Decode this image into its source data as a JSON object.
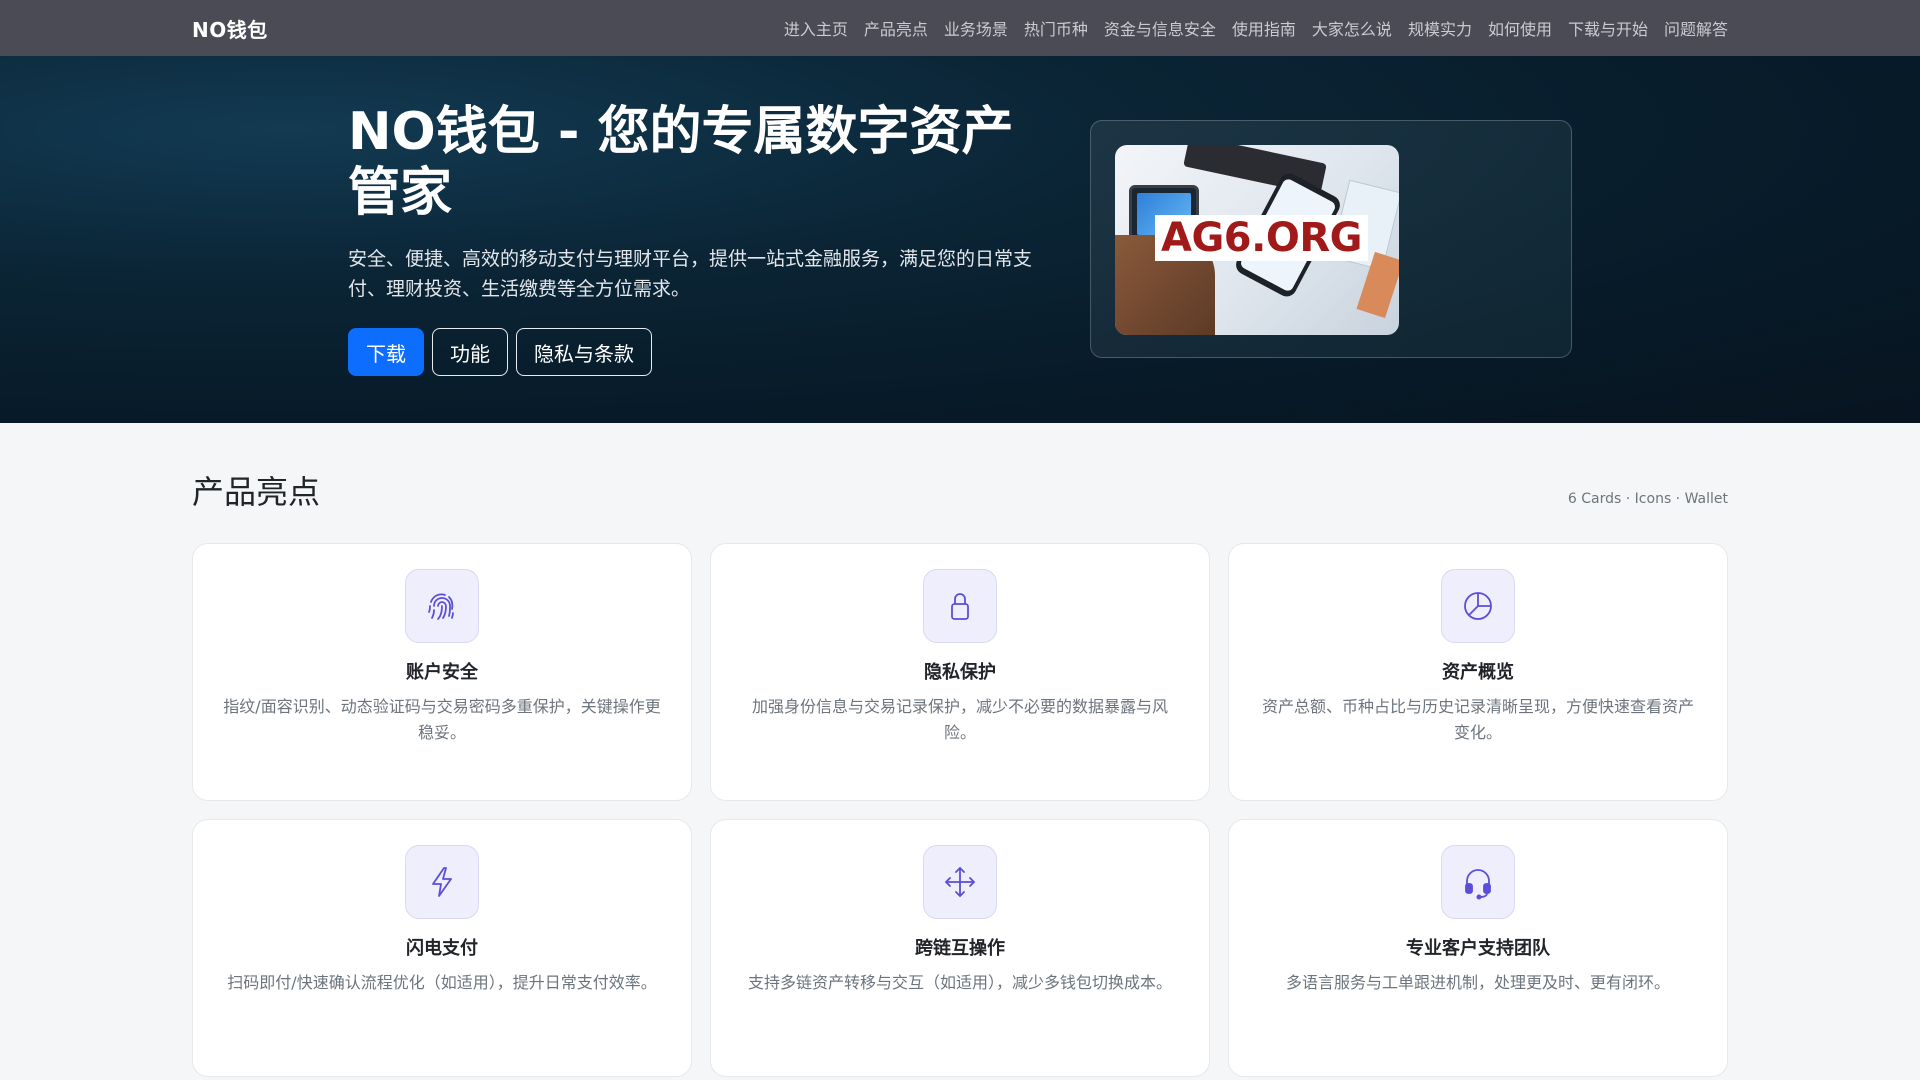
{
  "nav": {
    "brand": "NO钱包",
    "links": [
      "进入主页",
      "产品亮点",
      "业务场景",
      "热门币种",
      "资金与信息安全",
      "使用指南",
      "大家怎么说",
      "规模实力",
      "如何使用",
      "下载与开始",
      "问题解答"
    ]
  },
  "hero": {
    "title": "NO钱包 - 您的专属数字资产管家",
    "subtitle": "安全、便捷、高效的移动支付与理财平台，提供一站式金融服务，满足您的日常支付、理财投资、生活缴费等全方位需求。",
    "buttons": {
      "download": "下载",
      "features": "功能",
      "privacy": "隐私与条款"
    },
    "image_watermark": "AG6.ORG"
  },
  "features": {
    "title": "产品亮点",
    "meta": "6 Cards · Icons · Wallet",
    "cards": [
      {
        "icon": "fingerprint-icon",
        "title": "账户安全",
        "desc": "指纹/面容识别、动态验证码与交易密码多重保护，关键操作更稳妥。"
      },
      {
        "icon": "lock-icon",
        "title": "隐私保护",
        "desc": "加强身份信息与交易记录保护，减少不必要的数据暴露与风险。"
      },
      {
        "icon": "pie-chart-icon",
        "title": "资产概览",
        "desc": "资产总额、币种占比与历史记录清晰呈现，方便快速查看资产变化。"
      },
      {
        "icon": "lightning-icon",
        "title": "闪电支付",
        "desc": "扫码即付/快速确认流程优化（如适用），提升日常支付效率。"
      },
      {
        "icon": "arrows-move-icon",
        "title": "跨链互操作",
        "desc": "支持多链资产转移与交互（如适用），减少多钱包切换成本。"
      },
      {
        "icon": "headset-icon",
        "title": "专业客户支持团队",
        "desc": "多语言服务与工单跟进机制，处理更及时、更有闭环。"
      }
    ]
  },
  "colors": {
    "primary": "#0d6efd",
    "navbar": "#4a4b55",
    "icon_accent": "#5b4fd6"
  }
}
